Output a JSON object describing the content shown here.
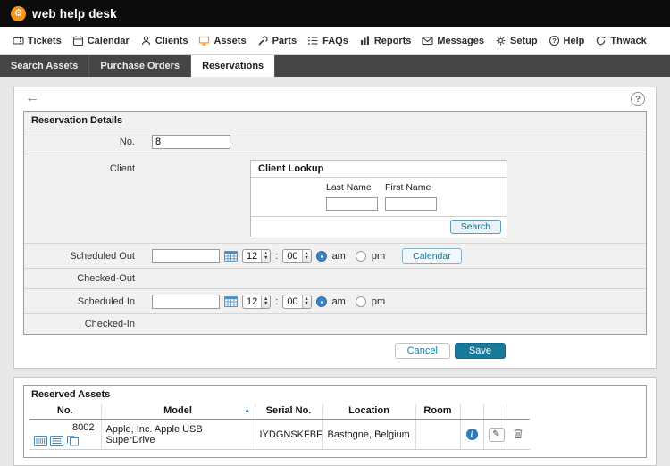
{
  "brand": {
    "logo_text": "web help desk"
  },
  "nav": {
    "items": [
      {
        "label": "Tickets"
      },
      {
        "label": "Calendar"
      },
      {
        "label": "Clients"
      },
      {
        "label": "Assets"
      },
      {
        "label": "Parts"
      },
      {
        "label": "FAQs"
      },
      {
        "label": "Reports"
      },
      {
        "label": "Messages"
      },
      {
        "label": "Setup"
      },
      {
        "label": "Help"
      },
      {
        "label": "Thwack"
      }
    ]
  },
  "tabs": {
    "items": [
      {
        "label": "Search Assets",
        "active": false
      },
      {
        "label": "Purchase Orders",
        "active": false
      },
      {
        "label": "Reservations",
        "active": true
      }
    ]
  },
  "reservation": {
    "section_title": "Reservation Details",
    "no_label": "No.",
    "no_value": "8",
    "client_label": "Client",
    "client_lookup": {
      "title": "Client Lookup",
      "last_name_label": "Last Name",
      "first_name_label": "First Name",
      "search_button": "Search"
    },
    "scheduled_out_label": "Scheduled Out",
    "checked_out_label": "Checked-Out",
    "scheduled_in_label": "Scheduled In",
    "checked_in_label": "Checked-In",
    "time": {
      "hour": "12",
      "minute": "00",
      "separator": ":",
      "am_label": "am",
      "pm_label": "pm"
    },
    "calendar_button": "Calendar",
    "cancel_button": "Cancel",
    "save_button": "Save"
  },
  "reserved_assets": {
    "section_title": "Reserved Assets",
    "columns": {
      "no": "No.",
      "model": "Model",
      "serial": "Serial No.",
      "location": "Location",
      "room": "Room"
    },
    "rows": [
      {
        "no": "8002",
        "model": "Apple, Inc. Apple USB SuperDrive",
        "serial": "IYDGNSKFBF",
        "location": "Bastogne, Belgium",
        "room": ""
      }
    ]
  },
  "colors": {
    "accent_orange": "#f7941e",
    "teal": "#19799a",
    "link_blue": "#2e79ba",
    "topbar": "#0c0c0c"
  }
}
